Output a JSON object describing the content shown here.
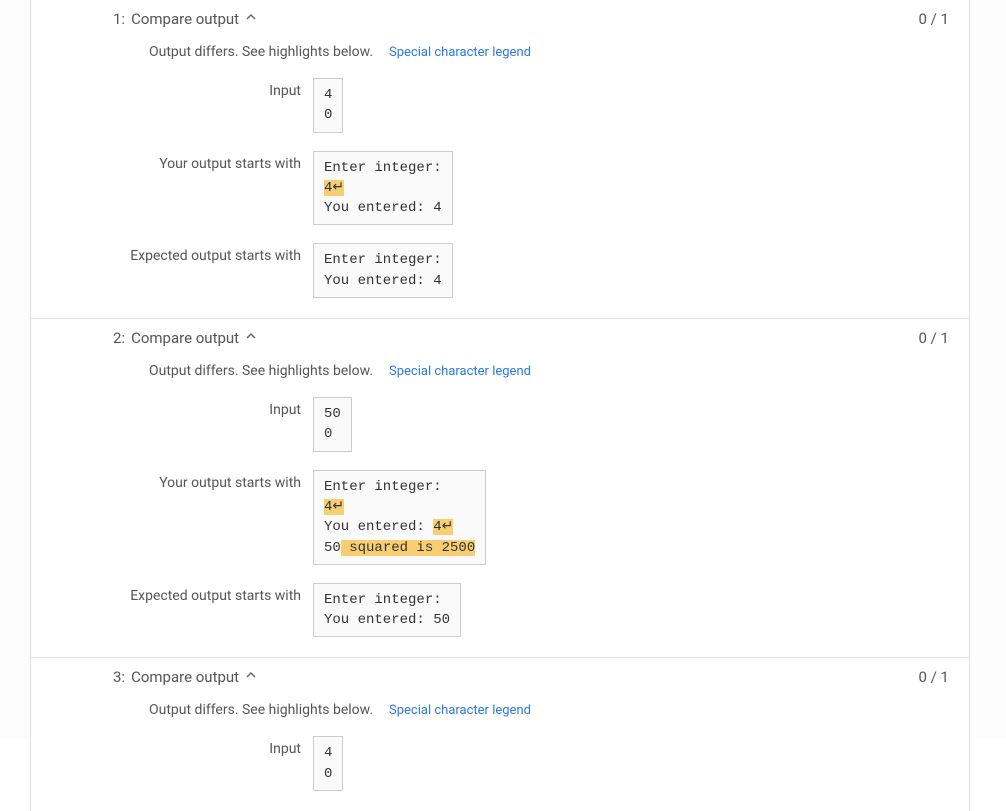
{
  "labels": {
    "compare_output": "Compare output",
    "diff_message": "Output differs. See highlights below.",
    "legend": "Special character legend",
    "input": "Input",
    "your_output": "Your output starts with",
    "expected_output": "Expected output starts with",
    "nl_symbol": "↵"
  },
  "tests": [
    {
      "index": "1:",
      "score": "0 / 1",
      "input_lines": [
        "4",
        "0"
      ],
      "your_output": {
        "segments": [
          {
            "t": "Enter integer:\n"
          },
          {
            "t": "4",
            "hl": true
          },
          {
            "t": "↵",
            "hl": true,
            "nl": true
          },
          {
            "t": "\nYou entered: 4"
          }
        ]
      },
      "expected_output": {
        "segments": [
          {
            "t": "Enter integer:\nYou entered: 4"
          }
        ]
      }
    },
    {
      "index": "2:",
      "score": "0 / 1",
      "input_lines": [
        "50",
        "0"
      ],
      "your_output": {
        "segments": [
          {
            "t": "Enter integer:\n"
          },
          {
            "t": "4",
            "hl": true
          },
          {
            "t": "↵",
            "hl": true,
            "nl": true
          },
          {
            "t": "\nYou entered: "
          },
          {
            "t": "4",
            "hl": true
          },
          {
            "t": "↵",
            "hl": true,
            "nl": true
          },
          {
            "t": "\n50"
          },
          {
            "t": " squared is 2500",
            "hl": true
          }
        ]
      },
      "expected_output": {
        "segments": [
          {
            "t": "Enter integer:\nYou entered: 50"
          }
        ]
      }
    },
    {
      "index": "3:",
      "score": "0 / 1",
      "input_lines": [
        "4",
        "0"
      ],
      "your_output": null,
      "expected_output": null
    }
  ]
}
